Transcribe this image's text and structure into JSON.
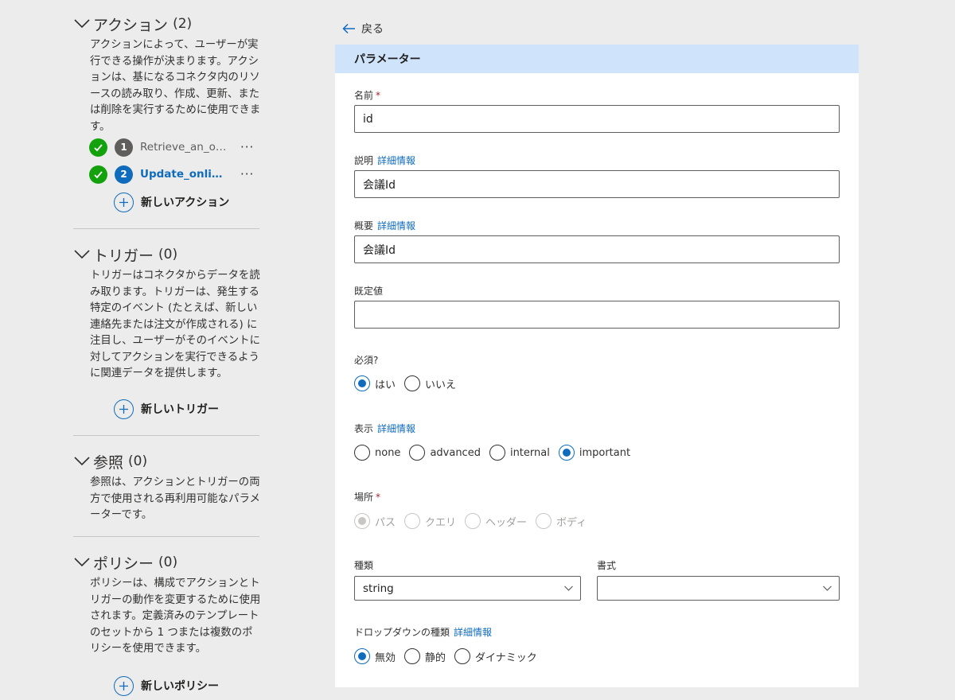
{
  "sidebar": {
    "actions": {
      "title": "アクション",
      "count": "(2)",
      "description": "アクションによって、ユーザーが実行できる操作が決まります。アクションは、基になるコネクタ内のリソースの読み取り、作成、更新、または削除を実行するために使用できます。",
      "items": [
        {
          "number": "1",
          "name": "Retrieve_an_onl...",
          "menu": "···"
        },
        {
          "number": "2",
          "name": "Update_onlin...",
          "menu": "···"
        }
      ],
      "add_label": "新しいアクション"
    },
    "triggers": {
      "title": "トリガー",
      "count": "(0)",
      "description": "トリガーはコネクタからデータを読み取ります。トリガーは、発生する特定のイベント (たとえば、新しい連絡先または注文が作成される) に注目し、ユーザーがそのイベントに対してアクションを実行できるように関連データを提供します。",
      "add_label": "新しいトリガー"
    },
    "references": {
      "title": "参照",
      "count": "(0)",
      "description": "参照は、アクションとトリガーの両方で使用される再利用可能なパラメーターです。"
    },
    "policies": {
      "title": "ポリシー",
      "count": "(0)",
      "description": "ポリシーは、構成でアクションとトリガーの動作を変更するために使用されます。定義済みのテンプレートのセットから 1 つまたは複数のポリシーを使用できます。",
      "add_label": "新しいポリシー"
    }
  },
  "back_label": "戻る",
  "panel": {
    "title": "パラメーター",
    "name": {
      "label": "名前",
      "required": "*",
      "value": "id"
    },
    "description": {
      "label": "説明",
      "link": "詳細情報",
      "value": "会議Id"
    },
    "summary": {
      "label": "概要",
      "link": "詳細情報",
      "value": "会議Id"
    },
    "default": {
      "label": "既定値",
      "value": ""
    },
    "required": {
      "label": "必須?",
      "options": [
        "はい",
        "いいえ"
      ],
      "selected": "はい"
    },
    "visibility": {
      "label": "表示",
      "link": "詳細情報",
      "options": [
        "none",
        "advanced",
        "internal",
        "important"
      ],
      "selected": "important"
    },
    "location": {
      "label": "場所",
      "required": "*",
      "options": [
        "パス",
        "クエリ",
        "ヘッダー",
        "ボディ"
      ],
      "selected": "パス",
      "disabled": true
    },
    "type": {
      "label": "種類",
      "value": "string"
    },
    "format": {
      "label": "書式",
      "value": ""
    },
    "dropdown": {
      "label": "ドロップダウンの種類",
      "link": "詳細情報",
      "options": [
        "無効",
        "静的",
        "ダイナミック"
      ],
      "selected": "無効"
    }
  },
  "colors": {
    "accent": "#0f6cbd",
    "success": "#13a10e",
    "header_bg": "#cfe3fb",
    "page_bg": "#ececec"
  }
}
